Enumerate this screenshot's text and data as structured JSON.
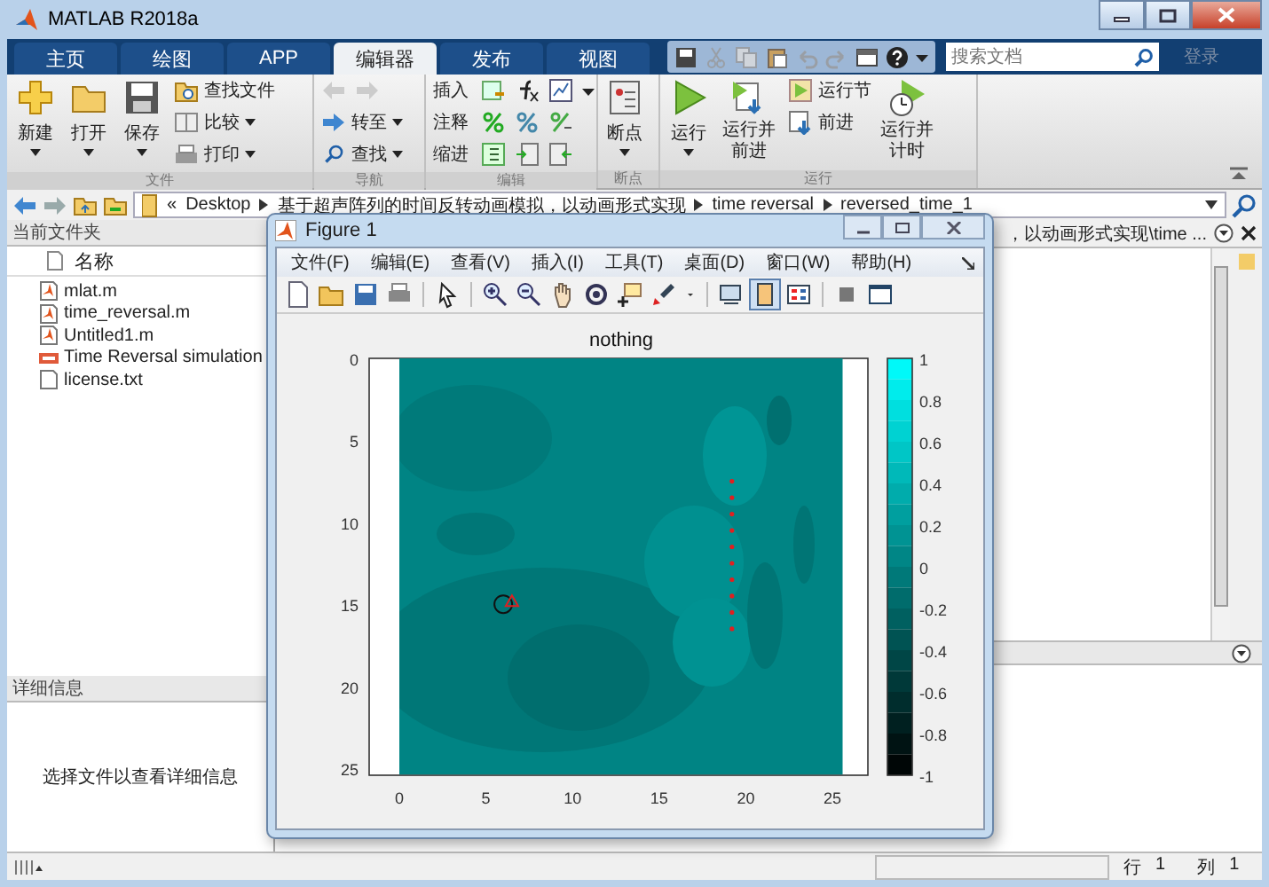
{
  "window": {
    "title": "MATLAB R2018a"
  },
  "ribbon_tabs": [
    {
      "label": "主页",
      "selected": false
    },
    {
      "label": "绘图",
      "selected": false
    },
    {
      "label": "APP",
      "selected": false
    },
    {
      "label": "编辑器",
      "selected": true
    },
    {
      "label": "发布",
      "selected": false
    },
    {
      "label": "视图",
      "selected": false
    }
  ],
  "search": {
    "placeholder": "搜索文档"
  },
  "sign_in": "登录",
  "ribbon": {
    "file": {
      "label": "文件",
      "new": "新建",
      "open": "打开",
      "save": "保存",
      "find_files": "查找文件",
      "compare": "比较",
      "print": "打印"
    },
    "navigate": {
      "label": "导航",
      "go_to": "转至",
      "find": "查找"
    },
    "edit": {
      "label": "编辑",
      "insert": "插入",
      "comment": "注释",
      "indent": "缩进"
    },
    "breakpoints": {
      "label": "断点",
      "breakpoints": "断点"
    },
    "run": {
      "label": "运行",
      "run": "运行",
      "run_and_advance": "运行并前进",
      "run_section": "运行节",
      "advance": "前进",
      "run_and_time": "运行并计时"
    }
  },
  "address_bar": {
    "prefix": "«",
    "path": [
      "Desktop",
      "基于超声阵列的时间反转动画模拟，以动画形式实现",
      "time reversal",
      "reversed_time_1"
    ]
  },
  "current_folder": {
    "title": "当前文件夹",
    "column": "名称",
    "files": [
      {
        "name": "mlat.m",
        "kind": "mfile"
      },
      {
        "name": "time_reversal.m",
        "kind": "mfile"
      },
      {
        "name": "Untitled1.m",
        "kind": "mfile"
      },
      {
        "name": "Time Reversal simulation",
        "kind": "media"
      },
      {
        "name": "license.txt",
        "kind": "text"
      }
    ]
  },
  "details": {
    "title": "详细信息",
    "message": "选择文件以查看详细信息"
  },
  "editor": {
    "title": "，以动画形式实现\\time ..."
  },
  "figure": {
    "title": "Figure 1",
    "menu": [
      "文件(F)",
      "编辑(E)",
      "查看(V)",
      "插入(I)",
      "工具(T)",
      "桌面(D)",
      "窗口(W)",
      "帮助(H)"
    ],
    "colorbar_button_on": true,
    "plot": {
      "title": "nothing",
      "x_ticks": [
        "0",
        "5",
        "10",
        "15",
        "20",
        "25"
      ],
      "y_ticks": [
        "0",
        "5",
        "10",
        "15",
        "20",
        "25"
      ],
      "colorbar_ticks": [
        "1",
        "0.8",
        "0.6",
        "0.4",
        "0.2",
        "0",
        "-0.2",
        "-0.4",
        "-0.6",
        "-0.8",
        "-1"
      ]
    }
  },
  "status_bar": {
    "row_label": "行",
    "row": "1",
    "col_label": "列",
    "col": "1"
  }
}
